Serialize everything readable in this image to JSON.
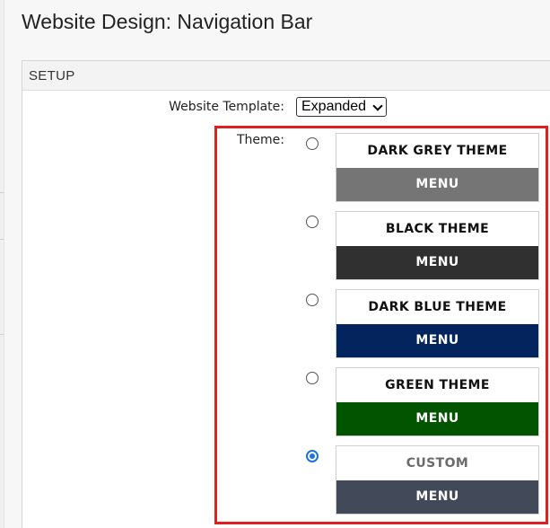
{
  "page": {
    "title": "Website Design: Navigation Bar"
  },
  "setup": {
    "header": "SETUP",
    "template_label": "Website Template:",
    "template_value": "Expanded",
    "theme_label": "Theme:"
  },
  "themes": [
    {
      "name": "DARK GREY THEME",
      "menu": "MENU",
      "menu_color": "#757575",
      "name_color": "#111111",
      "selected": false
    },
    {
      "name": "BLACK THEME",
      "menu": "MENU",
      "menu_color": "#303030",
      "name_color": "#111111",
      "selected": false
    },
    {
      "name": "DARK BLUE THEME",
      "menu": "MENU",
      "menu_color": "#03245c",
      "name_color": "#111111",
      "selected": false
    },
    {
      "name": "GREEN THEME",
      "menu": "MENU",
      "menu_color": "#035400",
      "name_color": "#111111",
      "selected": false
    },
    {
      "name": "CUSTOM",
      "menu": "MENU",
      "menu_color": "#424a5a",
      "name_color": "#6b6b6b",
      "selected": true
    }
  ],
  "colors": {
    "highlight": "#e02020",
    "radio_checked": "#1a73e8"
  }
}
